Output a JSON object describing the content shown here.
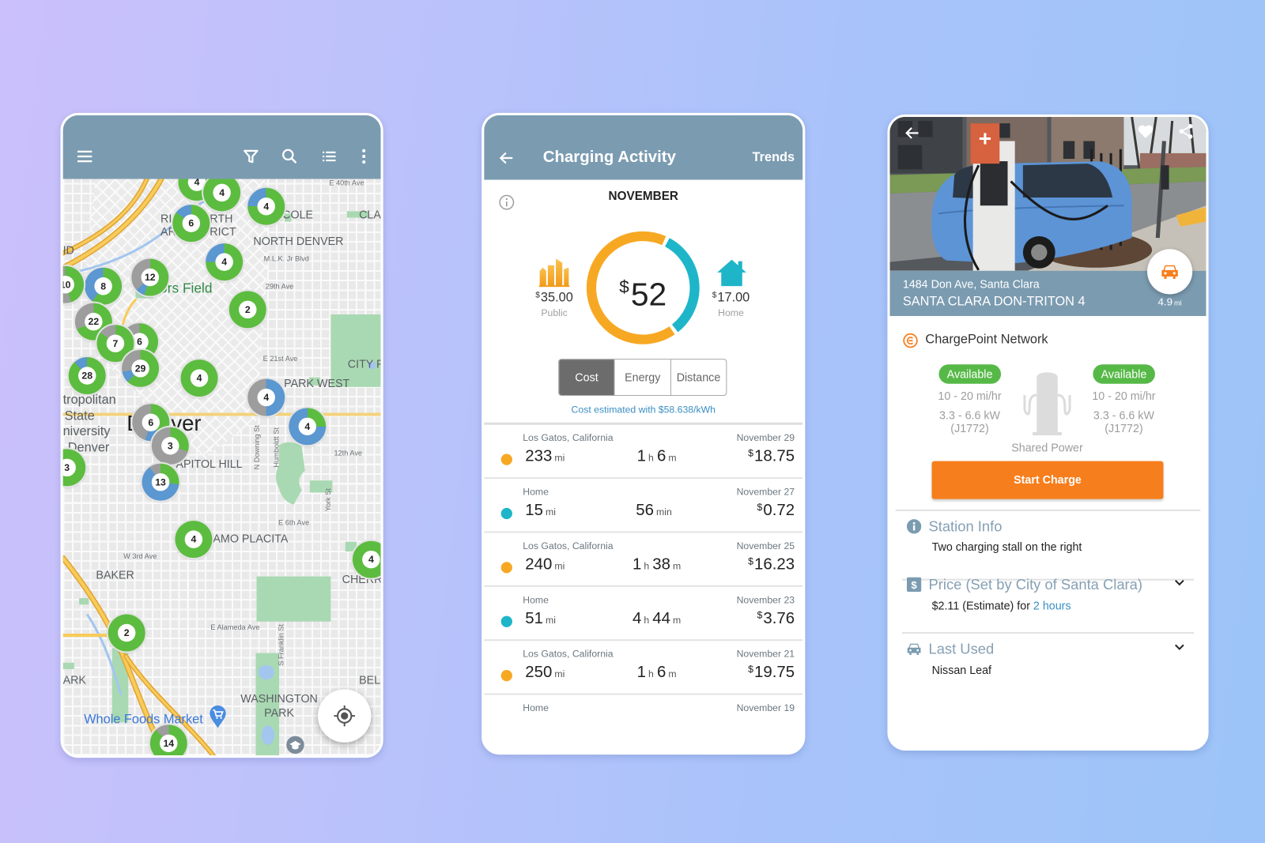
{
  "colors": {
    "header": "#7b9bb0",
    "public": "#f7a823",
    "home": "#1fb5c9",
    "available": "#56b947",
    "start_charge": "#f77e1c",
    "link": "#3a8fc4",
    "cluster_green": "#5cbc3f",
    "cluster_blue": "#5b97d0",
    "cluster_gray": "#9d9d9d"
  },
  "map_screen": {
    "toolbar": {
      "menu_icon": "hamburger-menu-icon",
      "filter_icon": "filter-icon",
      "search_icon": "search-icon",
      "list_icon": "list-view-icon",
      "more_icon": "more-vertical-icon"
    },
    "clusters": [
      {
        "count": "4",
        "green": 0.85,
        "blue": 0,
        "gray": 0.15
      },
      {
        "count": "4",
        "green": 1,
        "blue": 0,
        "gray": 0
      },
      {
        "count": "4",
        "green": 0.75,
        "blue": 0.25,
        "gray": 0
      },
      {
        "count": "6",
        "green": 0.85,
        "blue": 0.15,
        "gray": 0
      },
      {
        "count": "4",
        "green": 0.75,
        "blue": 0.25,
        "gray": 0
      },
      {
        "count": "12",
        "green": 0.55,
        "blue": 0.08,
        "gray": 0.37
      },
      {
        "count": "8",
        "green": 0.6,
        "blue": 0.4,
        "gray": 0
      },
      {
        "count": "10",
        "green": 0.45,
        "blue": 0,
        "gray": 0.55
      },
      {
        "count": "2",
        "green": 1,
        "blue": 0,
        "gray": 0
      },
      {
        "count": "22",
        "green": 0.68,
        "blue": 0,
        "gray": 0.32
      },
      {
        "count": "6",
        "green": 0.8,
        "blue": 0,
        "gray": 0.2
      },
      {
        "count": "7",
        "green": 0.85,
        "blue": 0,
        "gray": 0.15
      },
      {
        "count": "29",
        "green": 0.62,
        "blue": 0.1,
        "gray": 0.28
      },
      {
        "count": "28",
        "green": 0.88,
        "blue": 0.12,
        "gray": 0
      },
      {
        "count": "4",
        "green": 1,
        "blue": 0,
        "gray": 0
      },
      {
        "count": "4",
        "green": 0,
        "blue": 0.5,
        "gray": 0.5
      },
      {
        "count": "4",
        "green": 0.25,
        "blue": 0.75,
        "gray": 0
      },
      {
        "count": "6",
        "green": 0.4,
        "blue": 0.15,
        "gray": 0.45
      },
      {
        "count": "3",
        "green": 0.3,
        "blue": 0,
        "gray": 0.7
      },
      {
        "count": "3",
        "green": 1,
        "blue": 0,
        "gray": 0
      },
      {
        "count": "13",
        "green": 0.27,
        "blue": 0.63,
        "gray": 0.1
      },
      {
        "count": "4",
        "green": 1,
        "blue": 0,
        "gray": 0
      },
      {
        "count": "4",
        "green": 1,
        "blue": 0,
        "gray": 0
      },
      {
        "count": "2",
        "green": 1,
        "blue": 0,
        "gray": 0
      },
      {
        "count": "14",
        "green": 0.88,
        "blue": 0,
        "gray": 0.12
      }
    ],
    "labels": [
      "E 40th Ave",
      "RI",
      "RTH",
      "AR",
      "RICT",
      "COLE",
      "CLA",
      "NORTH DENVER",
      "M.L.K. Jr Blvd",
      "29th Ave",
      "ID",
      "ors Field",
      "E 21st Ave",
      "CITY P",
      "PARK WEST",
      "tropolitan",
      "State",
      "niversity",
      "Denver",
      "D",
      "ver",
      "APITOL HILL",
      "12th Ave",
      "N Downing St",
      "Humboldt St",
      "York St",
      "E 6th Ave",
      "AMO PLACITA",
      "W 3rd Ave",
      "BAKER",
      "CHERR",
      "E Alameda Ave",
      "S Franklin St",
      "ARK",
      "BEL",
      "WASHINGTON",
      "PARK",
      "Whole Foods Market"
    ],
    "poi_icons": {
      "shopping": "shopping-cart-pin-icon",
      "school": "school-pin-icon"
    },
    "locate_icon": "my-location-icon"
  },
  "activity": {
    "back_icon": "back-arrow-icon",
    "title": "Charging Activity",
    "trends": "Trends",
    "info_icon": "info-outline-icon",
    "month": "NOVEMBER",
    "total": {
      "currency": "$",
      "amount": "52",
      "value": 52
    },
    "public": {
      "currency": "$",
      "amount": "35.00",
      "label": "Public",
      "value": 35
    },
    "home": {
      "currency": "$",
      "amount": "17.00",
      "label": "Home",
      "value": 17
    },
    "tabs": [
      {
        "label": "Cost",
        "active": true
      },
      {
        "label": "Energy",
        "active": false
      },
      {
        "label": "Distance",
        "active": false
      }
    ],
    "note": "Cost estimated with $58.638/kWh",
    "sessions": [
      {
        "location": "Los Gatos, California",
        "type": "public",
        "distance": "233",
        "distance_unit": "mi",
        "dur_a": "1",
        "dur_a_unit": "h",
        "dur_b": "6",
        "dur_b_unit": "m",
        "date": "November 29",
        "currency": "$",
        "cost": "18.75"
      },
      {
        "location": "Home",
        "type": "home",
        "distance": "15",
        "distance_unit": "mi",
        "dur_a": "56",
        "dur_a_unit": "min",
        "dur_b": null,
        "dur_b_unit": null,
        "date": "November 27",
        "currency": "$",
        "cost": "0.72"
      },
      {
        "location": "Los Gatos, California",
        "type": "public",
        "distance": "240",
        "distance_unit": "mi",
        "dur_a": "1",
        "dur_a_unit": "h",
        "dur_b": "38",
        "dur_b_unit": "m",
        "date": "November 25",
        "currency": "$",
        "cost": "16.23"
      },
      {
        "location": "Home",
        "type": "home",
        "distance": "51",
        "distance_unit": "mi",
        "dur_a": "4",
        "dur_a_unit": "h",
        "dur_b": "44",
        "dur_b_unit": "m",
        "date": "November 23",
        "currency": "$",
        "cost": "3.76"
      },
      {
        "location": "Los Gatos, California",
        "type": "public",
        "distance": "250",
        "distance_unit": "mi",
        "dur_a": "1",
        "dur_a_unit": "h",
        "dur_b": "6",
        "dur_b_unit": "m",
        "date": "November 21",
        "currency": "$",
        "cost": "19.75"
      },
      {
        "location": "Home",
        "type": "home",
        "date": "November 19"
      }
    ]
  },
  "station": {
    "back_icon": "back-arrow-icon",
    "favorite_icon": "heart-icon",
    "share_icon": "share-icon",
    "address": "1484 Don Ave, Santa Clara",
    "name": "SANTA CLARA DON-TRITON 4",
    "distance": "4.9",
    "distance_unit": "mi",
    "directions_icon": "car-icon",
    "network": "ChargePoint Network",
    "ports": [
      {
        "status": "Available",
        "speed": "10 - 20 mi/hr",
        "power": "3.3 - 6.6 kW",
        "connector": "(J1772)"
      },
      {
        "status": "Available",
        "speed": "10 - 20 mi/hr",
        "power": "3.3 - 6.6 kW",
        "connector": "(J1772)"
      }
    ],
    "shared_power": "Shared Power",
    "start_charge": "Start Charge",
    "sections": {
      "info": {
        "title": "Station Info",
        "body": "Two charging stall on the right"
      },
      "price": {
        "title": "Price (Set by City of Santa Clara)",
        "body": "$2.11 (Estimate) for",
        "link": "2 hours"
      },
      "last_used": {
        "title": "Last Used",
        "body": "Nissan Leaf"
      }
    }
  }
}
